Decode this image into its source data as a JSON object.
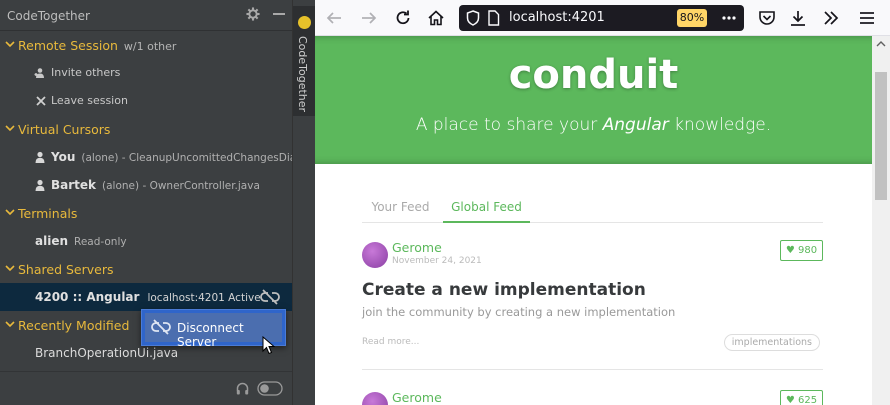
{
  "ide": {
    "title": "CodeTogether",
    "sections": {
      "remote": {
        "title": "Remote Session",
        "subtitle": "w/1 other",
        "items": [
          "Invite others",
          "Leave session"
        ]
      },
      "cursors": {
        "title": "Virtual Cursors",
        "items": [
          {
            "name": "You",
            "detail": "(alone) - CleanupUncomittedChangesDia"
          },
          {
            "name": "Bartek",
            "detail": "(alone) - OwnerController.java"
          }
        ]
      },
      "terminals": {
        "title": "Terminals",
        "items": [
          {
            "name": "alien",
            "detail": "Read-only"
          }
        ]
      },
      "servers": {
        "title": "Shared Servers",
        "items": [
          {
            "name": "4200 :: Angular",
            "detail": "localhost:4201 Active"
          }
        ]
      },
      "recent": {
        "title": "Recently Modified",
        "items": [
          "BranchOperationUi.java"
        ]
      }
    },
    "popup": {
      "label": "Disconnect Server"
    },
    "strip_label": "CodeTogether"
  },
  "browser": {
    "url": "localhost:4201",
    "zoom": "80%",
    "banner": {
      "title": "conduit",
      "subtitle_pre": "A place to share your ",
      "subtitle_em": "Angular",
      "subtitle_post": " knowledge."
    },
    "tabs": {
      "your_feed": "Your Feed",
      "global_feed": "Global Feed"
    },
    "articles": [
      {
        "author": "Gerome",
        "date": "November 24, 2021",
        "likes": "980",
        "title": "Create a new implementation",
        "description": "join the community by creating a new implementation",
        "read_more": "Read more...",
        "tag": "implementations"
      },
      {
        "author": "Gerome",
        "likes": "625"
      }
    ]
  },
  "colors": {
    "accent_green": "#5cb85c",
    "section_yellow": "#e8b93c",
    "selection": "#0d293e",
    "popup_blue": "#4b6eaf"
  }
}
